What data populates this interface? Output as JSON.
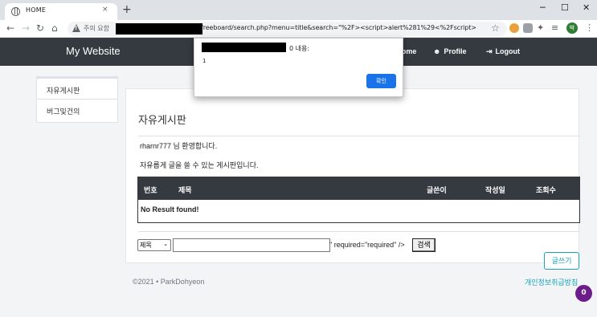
{
  "browser": {
    "tab_title": "HOME",
    "tab_close": "×",
    "new_tab": "+",
    "minimize": "─",
    "maximize": "☐",
    "close_window": "✕",
    "back": "←",
    "forward": "→",
    "reload": "↻",
    "home": "⌂",
    "insecure_label": "주의 요함",
    "url_tail": "freeboard/search.php?menu=title&search=\"%2F><script>alert%281%29<%2Fscript>",
    "star": "☆",
    "puzzle": "✦",
    "reading_list": "≡",
    "profile_initial": "박",
    "menu": "⋮"
  },
  "navbar": {
    "brand": "My Website",
    "home_label": "Home",
    "home_icon": "⌂",
    "profile_label": "Profile",
    "profile_icon": "☻",
    "logout_label": "Logout",
    "logout_icon": "⇥"
  },
  "sidebar": {
    "items": [
      {
        "label": "자유게시판"
      },
      {
        "label": "버그및건의"
      }
    ]
  },
  "main": {
    "title": "자유게시판",
    "welcome": "rharnr777 님 환영합니다.",
    "description": "자유롭게 글을 쓸 수 있는 게시판입니다.",
    "table": {
      "headers": [
        "번호",
        "제목",
        "글쓴이",
        "작성일",
        "조회수"
      ],
      "empty_message": "No Result found!"
    },
    "search": {
      "select_value": "제목",
      "caret": "⌄",
      "input_value": "",
      "leaked_text": "\" required=\"required\" />",
      "button_label": "검색"
    },
    "write_button": "글쓰기"
  },
  "footer": {
    "copyright": "©2021 • ParkDohyeon",
    "privacy": "개인정보취급방침",
    "badge_count": "0"
  },
  "dialog": {
    "title_suffix": "0 내용:",
    "message": "1",
    "ok_label": "확인"
  },
  "colors": {
    "navbar": "#343a40",
    "accent": "#17a2b8",
    "dialog_button": "#1a73e8",
    "badge": "#6b1d8a"
  }
}
